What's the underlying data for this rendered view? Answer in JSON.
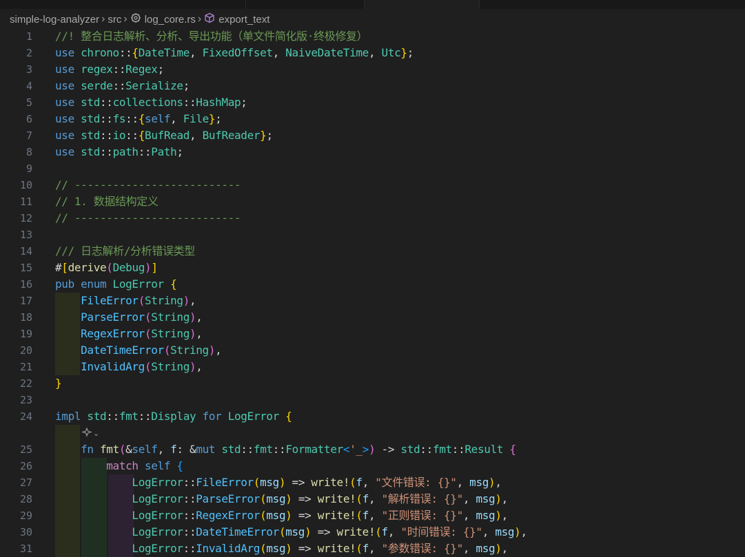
{
  "breadcrumb": {
    "project": "simple-log-analyzer",
    "folder": "src",
    "file": "log_core.rs",
    "symbol": "export_text"
  },
  "editor": {
    "lines": [
      {
        "n": "1",
        "tokens": [
          [
            "cm",
            "//! 整合日志解析、分析、导出功能（单文件简化版·终极修复）"
          ]
        ]
      },
      {
        "n": "2",
        "tokens": [
          [
            "kw",
            "use "
          ],
          [
            "ty",
            "chrono"
          ],
          [
            "pu",
            "::"
          ],
          [
            "b1",
            "{"
          ],
          [
            "ty",
            "DateTime"
          ],
          [
            "pu",
            ", "
          ],
          [
            "ty",
            "FixedOffset"
          ],
          [
            "pu",
            ", "
          ],
          [
            "ty",
            "NaiveDateTime"
          ],
          [
            "pu",
            ", "
          ],
          [
            "ty",
            "Utc"
          ],
          [
            "b1",
            "}"
          ],
          [
            "pu",
            ";"
          ]
        ]
      },
      {
        "n": "3",
        "tokens": [
          [
            "kw",
            "use "
          ],
          [
            "ty",
            "regex"
          ],
          [
            "pu",
            "::"
          ],
          [
            "ty",
            "Regex"
          ],
          [
            "pu",
            ";"
          ]
        ]
      },
      {
        "n": "4",
        "tokens": [
          [
            "kw",
            "use "
          ],
          [
            "ty",
            "serde"
          ],
          [
            "pu",
            "::"
          ],
          [
            "ty",
            "Serialize"
          ],
          [
            "pu",
            ";"
          ]
        ]
      },
      {
        "n": "5",
        "tokens": [
          [
            "kw",
            "use "
          ],
          [
            "ty",
            "std"
          ],
          [
            "pu",
            "::"
          ],
          [
            "ty",
            "collections"
          ],
          [
            "pu",
            "::"
          ],
          [
            "ty",
            "HashMap"
          ],
          [
            "pu",
            ";"
          ]
        ]
      },
      {
        "n": "6",
        "tokens": [
          [
            "kw",
            "use "
          ],
          [
            "ty",
            "std"
          ],
          [
            "pu",
            "::"
          ],
          [
            "ty",
            "fs"
          ],
          [
            "pu",
            "::"
          ],
          [
            "b1",
            "{"
          ],
          [
            "kw",
            "self"
          ],
          [
            "pu",
            ", "
          ],
          [
            "ty",
            "File"
          ],
          [
            "b1",
            "}"
          ],
          [
            "pu",
            ";"
          ]
        ]
      },
      {
        "n": "7",
        "tokens": [
          [
            "kw",
            "use "
          ],
          [
            "ty",
            "std"
          ],
          [
            "pu",
            "::"
          ],
          [
            "ty",
            "io"
          ],
          [
            "pu",
            "::"
          ],
          [
            "b1",
            "{"
          ],
          [
            "ty",
            "BufRead"
          ],
          [
            "pu",
            ", "
          ],
          [
            "ty",
            "BufReader"
          ],
          [
            "b1",
            "}"
          ],
          [
            "pu",
            ";"
          ]
        ]
      },
      {
        "n": "8",
        "tokens": [
          [
            "kw",
            "use "
          ],
          [
            "ty",
            "std"
          ],
          [
            "pu",
            "::"
          ],
          [
            "ty",
            "path"
          ],
          [
            "pu",
            "::"
          ],
          [
            "ty",
            "Path"
          ],
          [
            "pu",
            ";"
          ]
        ]
      },
      {
        "n": "9",
        "tokens": []
      },
      {
        "n": "10",
        "tokens": [
          [
            "cm",
            "// --------------------------"
          ]
        ]
      },
      {
        "n": "11",
        "tokens": [
          [
            "cm",
            "// 1. 数据结构定义"
          ]
        ]
      },
      {
        "n": "12",
        "tokens": [
          [
            "cm",
            "// --------------------------"
          ]
        ]
      },
      {
        "n": "13",
        "tokens": []
      },
      {
        "n": "14",
        "tokens": [
          [
            "cm",
            "/// 日志解析/分析错误类型"
          ]
        ]
      },
      {
        "n": "15",
        "tokens": [
          [
            "pu",
            "#"
          ],
          [
            "b1",
            "["
          ],
          [
            "fn",
            "derive"
          ],
          [
            "b2",
            "("
          ],
          [
            "ty",
            "Debug"
          ],
          [
            "b2",
            ")"
          ],
          [
            "b1",
            "]"
          ]
        ]
      },
      {
        "n": "16",
        "tokens": [
          [
            "kw",
            "pub enum "
          ],
          [
            "ty",
            "LogError"
          ],
          [
            "pu",
            " "
          ],
          [
            "b1",
            "{"
          ]
        ]
      },
      {
        "n": "17",
        "guides": 1,
        "tokens": [
          [
            "pu",
            "    "
          ],
          [
            "en",
            "FileError"
          ],
          [
            "b2",
            "("
          ],
          [
            "ty",
            "String"
          ],
          [
            "b2",
            ")"
          ],
          [
            "pu",
            ","
          ]
        ]
      },
      {
        "n": "18",
        "guides": 1,
        "tokens": [
          [
            "pu",
            "    "
          ],
          [
            "en",
            "ParseError"
          ],
          [
            "b2",
            "("
          ],
          [
            "ty",
            "String"
          ],
          [
            "b2",
            ")"
          ],
          [
            "pu",
            ","
          ]
        ]
      },
      {
        "n": "19",
        "guides": 1,
        "tokens": [
          [
            "pu",
            "    "
          ],
          [
            "en",
            "RegexError"
          ],
          [
            "b2",
            "("
          ],
          [
            "ty",
            "String"
          ],
          [
            "b2",
            ")"
          ],
          [
            "pu",
            ","
          ]
        ]
      },
      {
        "n": "20",
        "guides": 1,
        "tokens": [
          [
            "pu",
            "    "
          ],
          [
            "en",
            "DateTimeError"
          ],
          [
            "b2",
            "("
          ],
          [
            "ty",
            "String"
          ],
          [
            "b2",
            ")"
          ],
          [
            "pu",
            ","
          ]
        ]
      },
      {
        "n": "21",
        "guides": 1,
        "tokens": [
          [
            "pu",
            "    "
          ],
          [
            "en",
            "InvalidArg"
          ],
          [
            "b2",
            "("
          ],
          [
            "ty",
            "String"
          ],
          [
            "b2",
            ")"
          ],
          [
            "pu",
            ","
          ]
        ]
      },
      {
        "n": "22",
        "tokens": [
          [
            "b1",
            "}"
          ]
        ]
      },
      {
        "n": "23",
        "tokens": []
      },
      {
        "n": "24",
        "tokens": [
          [
            "kw",
            "impl "
          ],
          [
            "ty",
            "std"
          ],
          [
            "pu",
            "::"
          ],
          [
            "ty",
            "fmt"
          ],
          [
            "pu",
            "::"
          ],
          [
            "ty",
            "Display"
          ],
          [
            "kw",
            " for "
          ],
          [
            "ty",
            "LogError"
          ],
          [
            "pu",
            " "
          ],
          [
            "b1",
            "{"
          ]
        ]
      },
      {
        "n": "",
        "codelens": true,
        "guides": 1,
        "tokens": []
      },
      {
        "n": "25",
        "guides": 1,
        "tokens": [
          [
            "pu",
            "    "
          ],
          [
            "kw",
            "fn "
          ],
          [
            "fn",
            "fmt"
          ],
          [
            "b2",
            "("
          ],
          [
            "pu",
            "&"
          ],
          [
            "kw",
            "self"
          ],
          [
            "pu",
            ", "
          ],
          [
            "var",
            "f"
          ],
          [
            "pu",
            ": &"
          ],
          [
            "kw",
            "mut "
          ],
          [
            "ty",
            "std"
          ],
          [
            "pu",
            "::"
          ],
          [
            "ty",
            "fmt"
          ],
          [
            "pu",
            "::"
          ],
          [
            "ty",
            "Formatter"
          ],
          [
            "b3",
            "<"
          ],
          [
            "str",
            "'_"
          ],
          [
            "b3",
            ">"
          ],
          [
            "b2",
            ")"
          ],
          [
            "pu",
            " -> "
          ],
          [
            "ty",
            "std"
          ],
          [
            "pu",
            "::"
          ],
          [
            "ty",
            "fmt"
          ],
          [
            "pu",
            "::"
          ],
          [
            "ty",
            "Result"
          ],
          [
            "pu",
            " "
          ],
          [
            "b2",
            "{"
          ]
        ]
      },
      {
        "n": "26",
        "guides": 2,
        "tokens": [
          [
            "pu",
            "        "
          ],
          [
            "ctl",
            "match "
          ],
          [
            "kw",
            "self"
          ],
          [
            "pu",
            " "
          ],
          [
            "b3",
            "{"
          ]
        ]
      },
      {
        "n": "27",
        "guides": 3,
        "tokens": [
          [
            "pu",
            "            "
          ],
          [
            "ty",
            "LogError"
          ],
          [
            "pu",
            "::"
          ],
          [
            "en",
            "FileError"
          ],
          [
            "b1",
            "("
          ],
          [
            "var",
            "msg"
          ],
          [
            "b1",
            ")"
          ],
          [
            "pu",
            " => "
          ],
          [
            "fn",
            "write"
          ],
          [
            "fn",
            "!"
          ],
          [
            "b1",
            "("
          ],
          [
            "var",
            "f"
          ],
          [
            "pu",
            ", "
          ],
          [
            "str",
            "\"文件错误: {}\""
          ],
          [
            "pu",
            ", "
          ],
          [
            "var",
            "msg"
          ],
          [
            "b1",
            ")"
          ],
          [
            "pu",
            ","
          ]
        ]
      },
      {
        "n": "28",
        "guides": 3,
        "tokens": [
          [
            "pu",
            "            "
          ],
          [
            "ty",
            "LogError"
          ],
          [
            "pu",
            "::"
          ],
          [
            "en",
            "ParseError"
          ],
          [
            "b1",
            "("
          ],
          [
            "var",
            "msg"
          ],
          [
            "b1",
            ")"
          ],
          [
            "pu",
            " => "
          ],
          [
            "fn",
            "write"
          ],
          [
            "fn",
            "!"
          ],
          [
            "b1",
            "("
          ],
          [
            "var",
            "f"
          ],
          [
            "pu",
            ", "
          ],
          [
            "str",
            "\"解析错误: {}\""
          ],
          [
            "pu",
            ", "
          ],
          [
            "var",
            "msg"
          ],
          [
            "b1",
            ")"
          ],
          [
            "pu",
            ","
          ]
        ]
      },
      {
        "n": "29",
        "guides": 3,
        "tokens": [
          [
            "pu",
            "            "
          ],
          [
            "ty",
            "LogError"
          ],
          [
            "pu",
            "::"
          ],
          [
            "en",
            "RegexError"
          ],
          [
            "b1",
            "("
          ],
          [
            "var",
            "msg"
          ],
          [
            "b1",
            ")"
          ],
          [
            "pu",
            " => "
          ],
          [
            "fn",
            "write"
          ],
          [
            "fn",
            "!"
          ],
          [
            "b1",
            "("
          ],
          [
            "var",
            "f"
          ],
          [
            "pu",
            ", "
          ],
          [
            "str",
            "\"正则错误: {}\""
          ],
          [
            "pu",
            ", "
          ],
          [
            "var",
            "msg"
          ],
          [
            "b1",
            ")"
          ],
          [
            "pu",
            ","
          ]
        ]
      },
      {
        "n": "30",
        "guides": 3,
        "tokens": [
          [
            "pu",
            "            "
          ],
          [
            "ty",
            "LogError"
          ],
          [
            "pu",
            "::"
          ],
          [
            "en",
            "DateTimeError"
          ],
          [
            "b1",
            "("
          ],
          [
            "var",
            "msg"
          ],
          [
            "b1",
            ")"
          ],
          [
            "pu",
            " => "
          ],
          [
            "fn",
            "write"
          ],
          [
            "fn",
            "!"
          ],
          [
            "b1",
            "("
          ],
          [
            "var",
            "f"
          ],
          [
            "pu",
            ", "
          ],
          [
            "str",
            "\"时间错误: {}\""
          ],
          [
            "pu",
            ", "
          ],
          [
            "var",
            "msg"
          ],
          [
            "b1",
            ")"
          ],
          [
            "pu",
            ","
          ]
        ]
      },
      {
        "n": "31",
        "guides": 3,
        "tokens": [
          [
            "pu",
            "            "
          ],
          [
            "ty",
            "LogError"
          ],
          [
            "pu",
            "::"
          ],
          [
            "en",
            "InvalidArg"
          ],
          [
            "b1",
            "("
          ],
          [
            "var",
            "msg"
          ],
          [
            "b1",
            ")"
          ],
          [
            "pu",
            " => "
          ],
          [
            "fn",
            "write"
          ],
          [
            "fn",
            "!"
          ],
          [
            "b1",
            "("
          ],
          [
            "var",
            "f"
          ],
          [
            "pu",
            ", "
          ],
          [
            "str",
            "\"参数错误: {}\""
          ],
          [
            "pu",
            ", "
          ],
          [
            "var",
            "msg"
          ],
          [
            "b1",
            ")"
          ],
          [
            "pu",
            ","
          ]
        ]
      }
    ]
  },
  "colors": {
    "background": "#1f1f1f",
    "keyword": "#569cd6",
    "type": "#4ec9b0",
    "function": "#dcdcaa",
    "string": "#ce9178",
    "comment": "#6a9955",
    "line_number": "#6e7681"
  },
  "icons": {
    "file": "rust-file-icon",
    "symbol": "method-cube-icon",
    "codelens": "ai-sparkle-icon"
  }
}
